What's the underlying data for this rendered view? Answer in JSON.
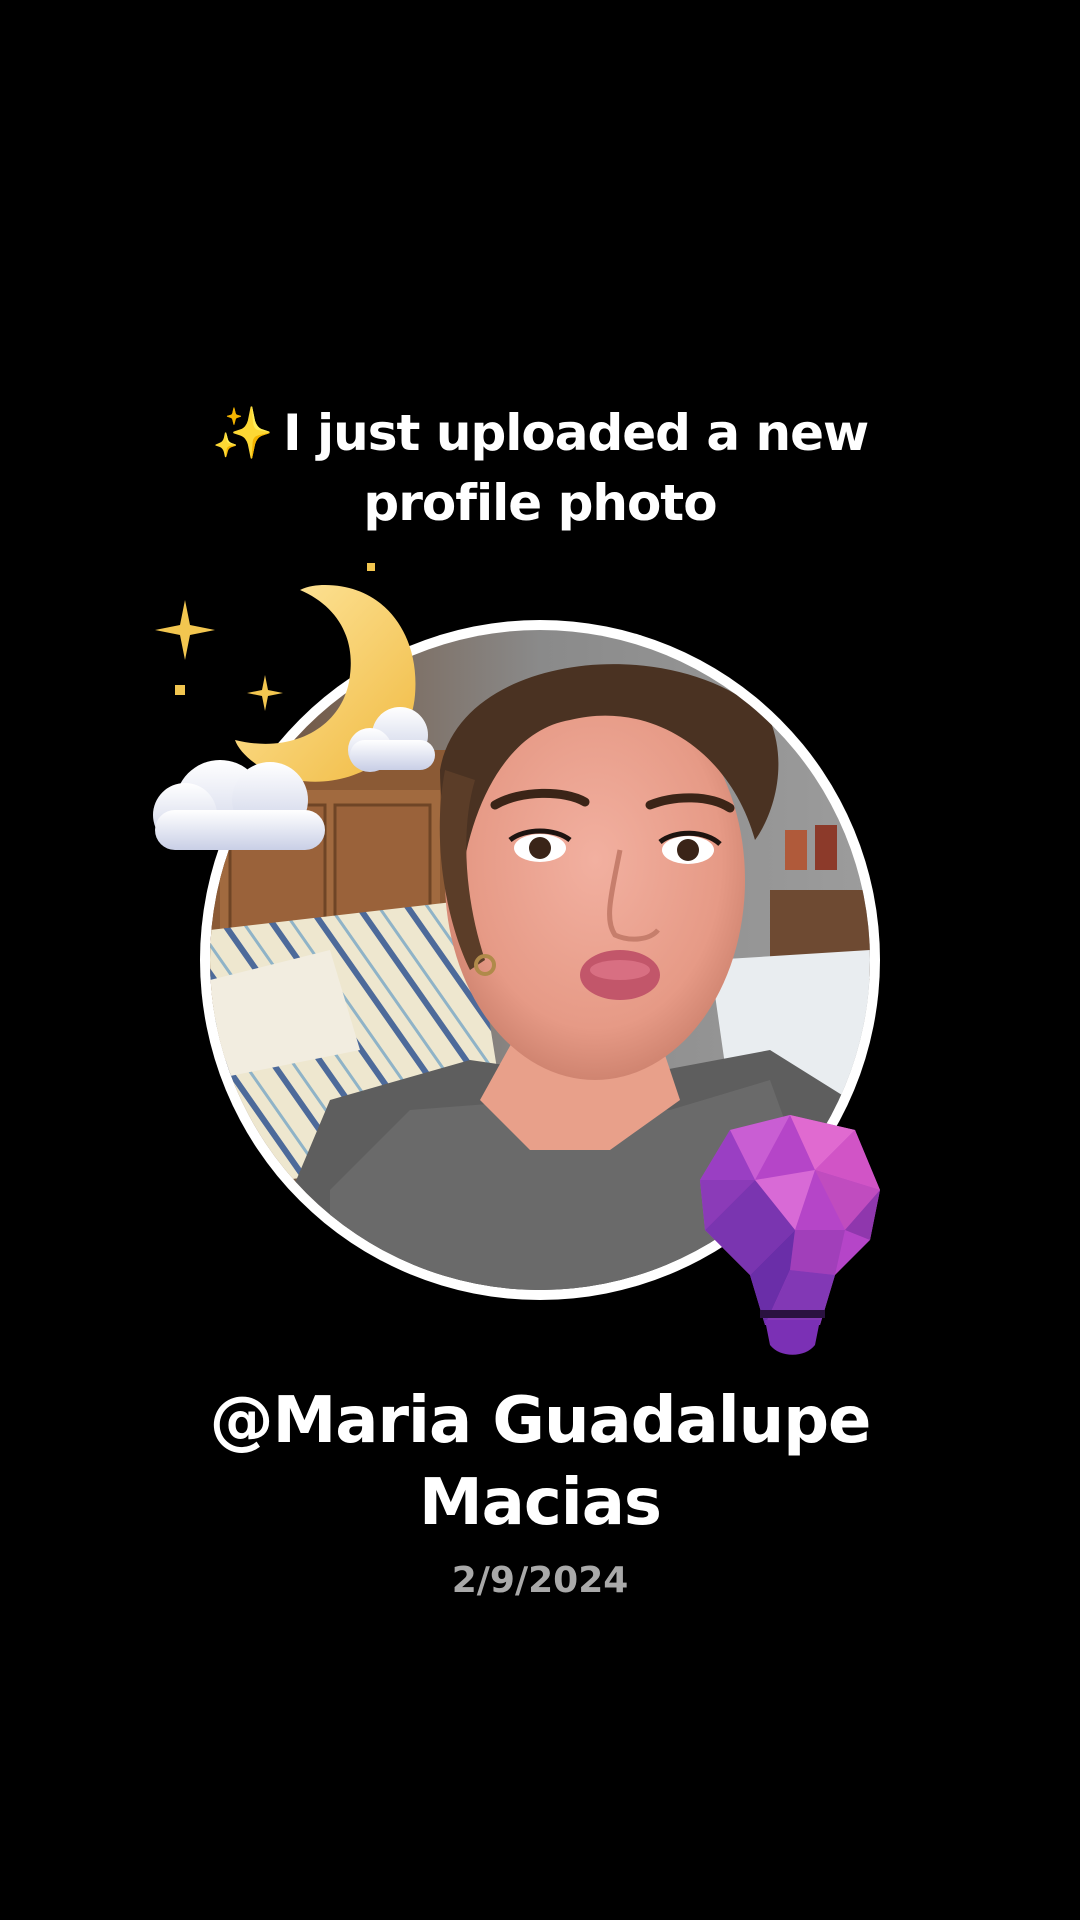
{
  "post": {
    "sparkle_emoji": "✨",
    "headline": "I just uploaded a new profile photo",
    "username": "@Maria Guadalupe Macias",
    "date": "2/9/2024"
  },
  "stickers": {
    "top_left": "moon-clouds-sticker",
    "bottom_right": "lightbulb-sticker"
  },
  "colors": {
    "background": "#000000",
    "text": "#ffffff",
    "date_text": "#a9a9a9",
    "ring": "#ffffff",
    "moon": "#f7cf5f",
    "bulb": "#b545c8"
  }
}
